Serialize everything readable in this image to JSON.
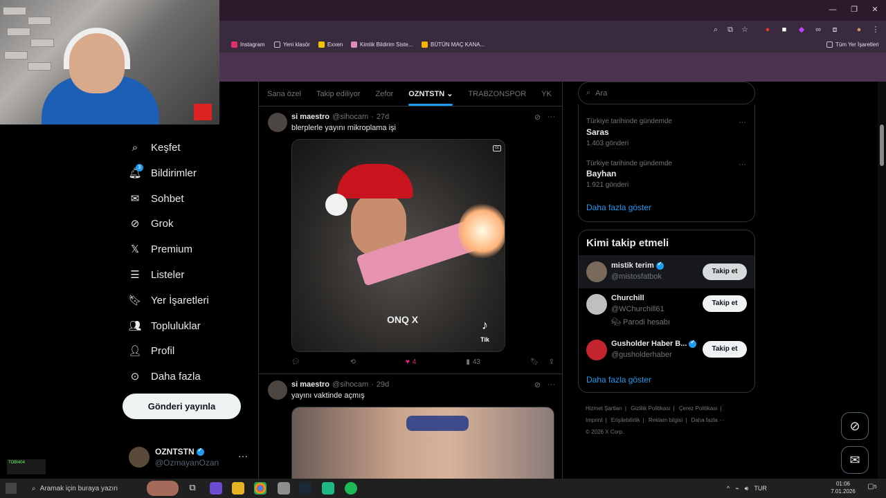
{
  "browser": {
    "bookmarks": [
      {
        "label": "Instagram",
        "color": "#e1306c"
      },
      {
        "label": "Yeni klasör",
        "color": "#c8bfc9"
      },
      {
        "label": "Exxen",
        "color": "#f5c400"
      },
      {
        "label": "Kimlik Bildirim Siste...",
        "color": "#e08bb0"
      },
      {
        "label": "BÜTÜN MAÇ KANA...",
        "color": "#f4b400"
      }
    ],
    "all_bookmarks": "Tüm Yer İşaretleri"
  },
  "nav": {
    "items": [
      {
        "label": "Keşfet",
        "icon": "search-icon"
      },
      {
        "label": "Bildirimler",
        "icon": "bell-icon",
        "badge": "3"
      },
      {
        "label": "Sohbet",
        "icon": "mail-icon"
      },
      {
        "label": "Grok",
        "icon": "grok-icon"
      },
      {
        "label": "Premium",
        "icon": "x-logo-icon"
      },
      {
        "label": "Listeler",
        "icon": "list-icon"
      },
      {
        "label": "Yer İşaretleri",
        "icon": "bookmark-icon"
      },
      {
        "label": "Topluluklar",
        "icon": "communities-icon"
      },
      {
        "label": "Profil",
        "icon": "profile-icon"
      },
      {
        "label": "Daha fazla",
        "icon": "more-circle-icon"
      }
    ],
    "post_button": "Gönderi yayınla",
    "profile": {
      "name": "OZNTSTN",
      "handle": "@OzmayanOzan"
    }
  },
  "timeline": {
    "tabs": [
      "Sana özel",
      "Takip ediliyor",
      "Zefor",
      "OZNTSTN",
      "TRABZONSPOR",
      "YK"
    ],
    "active_tab": "OZNTSTN",
    "tweets": [
      {
        "name": "si maestro",
        "handle": "@sihocam",
        "time": "27d",
        "text": "blerplerle yayını mikroplama işi",
        "media_caption": "ONQ X",
        "media_badge": "Tik",
        "likes": "4",
        "views": "43"
      },
      {
        "name": "si maestro",
        "handle": "@sihocam",
        "time": "29d",
        "text": "yayını vaktinde açmış"
      }
    ]
  },
  "search": {
    "placeholder": "Ara"
  },
  "trends": [
    {
      "context": "Türkiye tarihinde gündemde",
      "name": "Saras",
      "count": "1.403 gönderi"
    },
    {
      "context": "Türkiye tarihinde gündemde",
      "name": "Bayhan",
      "count": "1.921 gönderi"
    }
  ],
  "trends_more": "Daha fazla göster",
  "who_to_follow": {
    "title": "Kimi takip etmeli",
    "users": [
      {
        "name": "mistik terim",
        "handle": "@mistosfatbok",
        "verified": true,
        "extra": "",
        "button": "Takip et"
      },
      {
        "name": "Churchill",
        "handle": "@WChurchill61",
        "verified": false,
        "extra": "Parodi hesabı",
        "button": "Takip et"
      },
      {
        "name": "Gusholder Haber B...",
        "handle": "@gusholderhaber",
        "verified": true,
        "extra": "",
        "button": "Takip et"
      }
    ],
    "more": "Daha fazla göster"
  },
  "footer": [
    "Hizmet Şartları",
    "|",
    "Gizlilik Politikası",
    "|",
    "Çerez Politikası",
    "|",
    "Imprint",
    "|",
    "Erişilebilirlik",
    "|",
    "Reklam bilgisi",
    "|",
    "Daha fazla ···",
    "© 2026 X Corp."
  ],
  "taskbar": {
    "search_placeholder": "Aramak için buraya yazın",
    "lang": "TUR",
    "time": "01:06",
    "date": "7.01.2026",
    "notification_count": "5"
  },
  "overlay": {
    "tag": "TOBI404"
  },
  "colors": {
    "accent": "#1d9bf0",
    "like": "#f91880"
  }
}
